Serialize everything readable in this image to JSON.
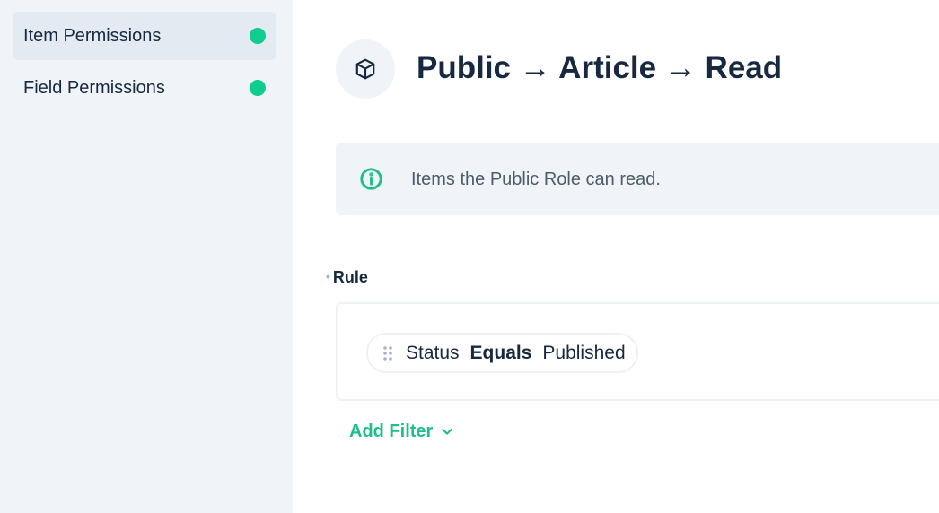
{
  "sidebar": {
    "items": [
      {
        "label": "Item Permissions",
        "active": true,
        "status_color": "#10cc8e"
      },
      {
        "label": "Field Permissions",
        "active": false,
        "status_color": "#10cc8e"
      }
    ]
  },
  "header": {
    "icon": "box-icon",
    "title": "Public → Article → Read"
  },
  "notice": {
    "icon": "info-icon",
    "text": "Items the Public Role can read."
  },
  "rule": {
    "label": "Rule",
    "filter": {
      "field": "Status",
      "operator": "Equals",
      "value": "Published"
    }
  },
  "add_filter": {
    "label": "Add Filter",
    "icon": "chevron-down-icon"
  },
  "colors": {
    "accent": "#1ebf8a",
    "status_dot": "#10cc8e",
    "text_primary": "#172940",
    "sidebar_bg": "#f0f4f9"
  }
}
